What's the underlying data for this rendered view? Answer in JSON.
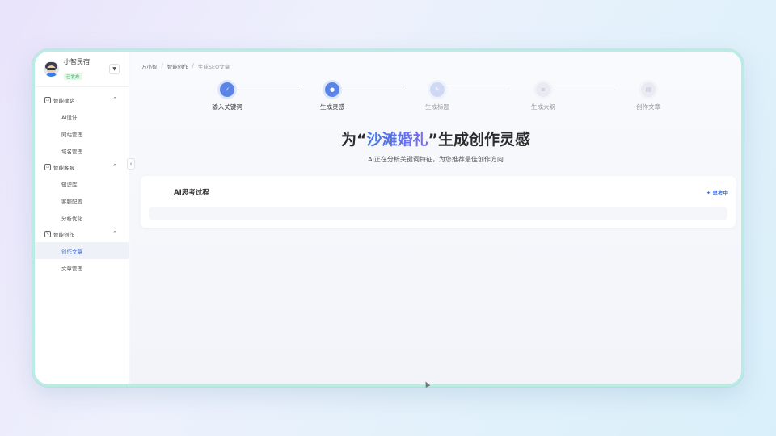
{
  "user": {
    "name": "小智民宿",
    "badge": "已发布",
    "dropdown_icon": "▼"
  },
  "sidebar": {
    "groups": [
      {
        "label": "智能建站",
        "icon": "site-icon",
        "items": [
          {
            "label": "AI设计"
          },
          {
            "label": "网站管理"
          },
          {
            "label": "域名管理"
          }
        ]
      },
      {
        "label": "智能客服",
        "icon": "chat-icon",
        "items": [
          {
            "label": "知识库"
          },
          {
            "label": "客服配置"
          },
          {
            "label": "分析优化"
          }
        ]
      },
      {
        "label": "智能创作",
        "icon": "edit-icon",
        "items": [
          {
            "label": "创作文章",
            "active": true
          },
          {
            "label": "文章管理"
          }
        ]
      }
    ],
    "collapse_icon": "‹"
  },
  "breadcrumb": [
    "万小智",
    "智能创作",
    "生成SEO文章"
  ],
  "steps": [
    {
      "label": "输入关键词",
      "state": "done"
    },
    {
      "label": "生成灵感",
      "state": "current"
    },
    {
      "label": "生成标题",
      "state": "next"
    },
    {
      "label": "生成大纲",
      "state": "todo"
    },
    {
      "label": "创作文章",
      "state": "todo"
    }
  ],
  "headline": {
    "prefix": "为“",
    "keyword": "沙滩婚礼",
    "suffix": "”生成创作灵感"
  },
  "subtitle": "AI正在分析关键词特征，为您推荐最佳创作方向",
  "thinking_card": {
    "title": "AI思考过程",
    "status": "思考中",
    "status_icon": "✦"
  },
  "colors": {
    "accent": "#5a84e6",
    "badge_green": "#3aae5c",
    "frame": "#b9ece2"
  }
}
